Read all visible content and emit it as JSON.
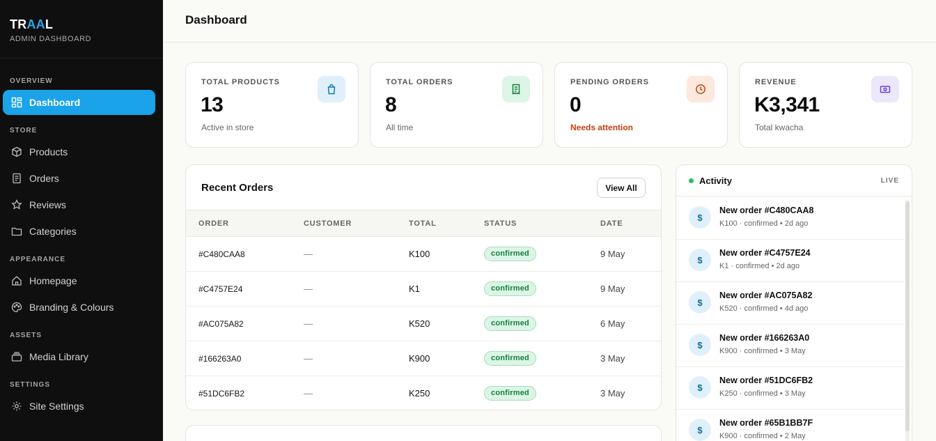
{
  "brand": {
    "name_part1": "TR",
    "name_part2": "AA",
    "name_part3": "L",
    "subtitle": "ADMIN DASHBOARD"
  },
  "sidebar": {
    "sections": {
      "overview": "OVERVIEW",
      "store": "STORE",
      "appearance": "APPEARANCE",
      "assets": "ASSETS",
      "settings": "SETTINGS"
    },
    "items": {
      "dashboard": "Dashboard",
      "products": "Products",
      "orders": "Orders",
      "reviews": "Reviews",
      "categories": "Categories",
      "homepage": "Homepage",
      "branding": "Branding & Colours",
      "media": "Media Library",
      "site_settings": "Site Settings"
    },
    "active": "Dashboard"
  },
  "header": {
    "title": "Dashboard"
  },
  "stats": [
    {
      "label": "TOTAL PRODUCTS",
      "value": "13",
      "sub": "Active in store",
      "icon": "shopping-bag-icon",
      "badge_bg": "#dff0fb",
      "badge_fg": "#0e78b8"
    },
    {
      "label": "TOTAL ORDERS",
      "value": "8",
      "sub": "All time",
      "icon": "receipt-icon",
      "badge_bg": "#dcf5e6",
      "badge_fg": "#16803c"
    },
    {
      "label": "PENDING ORDERS",
      "value": "0",
      "sub": "Needs attention",
      "icon": "clock-icon",
      "badge_bg": "#fde8dd",
      "badge_fg": "#c2410c"
    },
    {
      "label": "REVENUE",
      "value": "K3,341",
      "sub": "Total kwacha",
      "icon": "banknote-icon",
      "badge_bg": "#ece7fb",
      "badge_fg": "#6d3fd6"
    }
  ],
  "recent_orders": {
    "title": "Recent Orders",
    "view_all": "View All",
    "columns": [
      "ORDER",
      "CUSTOMER",
      "TOTAL",
      "STATUS",
      "DATE"
    ],
    "rows": [
      {
        "order": "#C480CAA8",
        "customer": "—",
        "total": "K100",
        "status": "confirmed",
        "date": "9 May"
      },
      {
        "order": "#C4757E24",
        "customer": "—",
        "total": "K1",
        "status": "confirmed",
        "date": "9 May"
      },
      {
        "order": "#AC075A82",
        "customer": "—",
        "total": "K520",
        "status": "confirmed",
        "date": "6 May"
      },
      {
        "order": "#166263A0",
        "customer": "—",
        "total": "K900",
        "status": "confirmed",
        "date": "3 May"
      },
      {
        "order": "#51DC6FB2",
        "customer": "—",
        "total": "K250",
        "status": "confirmed",
        "date": "3 May"
      }
    ]
  },
  "activity": {
    "title": "Activity",
    "live": "LIVE",
    "icon_glyph": "$",
    "items": [
      {
        "title": "New order #C480CAA8",
        "meta": "K100 · confirmed  •  2d ago"
      },
      {
        "title": "New order #C4757E24",
        "meta": "K1 · confirmed  •  2d ago"
      },
      {
        "title": "New order #AC075A82",
        "meta": "K520 · confirmed  •  4d ago"
      },
      {
        "title": "New order #166263A0",
        "meta": "K900 · confirmed  •  3 May"
      },
      {
        "title": "New order #51DC6FB2",
        "meta": "K250 · confirmed  •  3 May"
      },
      {
        "title": "New order #65B1BB7F",
        "meta": "K900 · confirmed  •  2 May"
      }
    ]
  },
  "colors": {
    "accent": "#1aa3e8",
    "sidebar_bg": "#0f0f0f",
    "status_green": "#15803d",
    "warning": "#c2410c"
  }
}
